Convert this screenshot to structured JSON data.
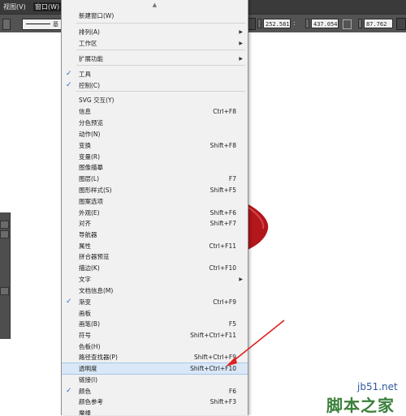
{
  "menubar": {
    "items": [
      {
        "label": "视图(V)"
      },
      {
        "label": "窗口(W)"
      }
    ]
  },
  "controlbar": {
    "stroke_label": "基",
    "x_value": "252.581",
    "y_value": "437.054",
    "w_value": "87.762 p"
  },
  "menu": {
    "items": [
      {
        "label": "新建窗口(W)",
        "shortcut": "",
        "checked": false,
        "submenu": false
      },
      {
        "label": "排列(A)",
        "shortcut": "",
        "checked": false,
        "submenu": true
      },
      {
        "label": "工作区",
        "shortcut": "",
        "checked": false,
        "submenu": true
      },
      {
        "label": "扩展功能",
        "shortcut": "",
        "checked": false,
        "submenu": true
      },
      {
        "label": "工具",
        "shortcut": "",
        "checked": true,
        "submenu": false
      },
      {
        "label": "控制(C)",
        "shortcut": "",
        "checked": true,
        "submenu": false
      },
      {
        "label": "SVG 交互(Y)",
        "shortcut": "",
        "checked": false,
        "submenu": false
      },
      {
        "label": "信息",
        "shortcut": "Ctrl+F8",
        "checked": false,
        "submenu": false
      },
      {
        "label": "分色预览",
        "shortcut": "",
        "checked": false,
        "submenu": false
      },
      {
        "label": "动作(N)",
        "shortcut": "",
        "checked": false,
        "submenu": false
      },
      {
        "label": "变换",
        "shortcut": "Shift+F8",
        "checked": false,
        "submenu": false
      },
      {
        "label": "变量(R)",
        "shortcut": "",
        "checked": false,
        "submenu": false
      },
      {
        "label": "图像描摹",
        "shortcut": "",
        "checked": false,
        "submenu": false
      },
      {
        "label": "图层(L)",
        "shortcut": "F7",
        "checked": false,
        "submenu": false
      },
      {
        "label": "图形样式(S)",
        "shortcut": "Shift+F5",
        "checked": false,
        "submenu": false
      },
      {
        "label": "图案选项",
        "shortcut": "",
        "checked": false,
        "submenu": false
      },
      {
        "label": "外观(E)",
        "shortcut": "Shift+F6",
        "checked": false,
        "submenu": false
      },
      {
        "label": "对齐",
        "shortcut": "Shift+F7",
        "checked": false,
        "submenu": false
      },
      {
        "label": "导航器",
        "shortcut": "",
        "checked": false,
        "submenu": false
      },
      {
        "label": "属性",
        "shortcut": "Ctrl+F11",
        "checked": false,
        "submenu": false
      },
      {
        "label": "拼合器预览",
        "shortcut": "",
        "checked": false,
        "submenu": false
      },
      {
        "label": "描边(K)",
        "shortcut": "Ctrl+F10",
        "checked": false,
        "submenu": false
      },
      {
        "label": "文字",
        "shortcut": "",
        "checked": false,
        "submenu": true
      },
      {
        "label": "文档信息(M)",
        "shortcut": "",
        "checked": false,
        "submenu": false
      },
      {
        "label": "渐变",
        "shortcut": "Ctrl+F9",
        "checked": true,
        "submenu": false
      },
      {
        "label": "画板",
        "shortcut": "",
        "checked": false,
        "submenu": false
      },
      {
        "label": "画笔(B)",
        "shortcut": "F5",
        "checked": false,
        "submenu": false
      },
      {
        "label": "符号",
        "shortcut": "Shift+Ctrl+F11",
        "checked": false,
        "submenu": false
      },
      {
        "label": "色板(H)",
        "shortcut": "",
        "checked": false,
        "submenu": false
      },
      {
        "label": "路径查找器(P)",
        "shortcut": "Shift+Ctrl+F9",
        "checked": false,
        "submenu": false
      },
      {
        "label": "透明度",
        "shortcut": "Shift+Ctrl+F10",
        "checked": false,
        "submenu": false,
        "highlighted": true
      },
      {
        "label": "链接(I)",
        "shortcut": "",
        "checked": false,
        "submenu": false
      },
      {
        "label": "颜色",
        "shortcut": "F6",
        "checked": true,
        "submenu": false
      },
      {
        "label": "颜色参考",
        "shortcut": "Shift+F3",
        "checked": false,
        "submenu": false
      },
      {
        "label": "魔棒",
        "shortcut": "",
        "checked": false,
        "submenu": false
      }
    ]
  },
  "watermark": {
    "url": "jb51.net",
    "name": "脚本之家"
  },
  "colors": {
    "accent": "#1a6fd6",
    "highlight": "#d9e7f7",
    "arrow": "#e02020",
    "shape": "#b3161b"
  }
}
